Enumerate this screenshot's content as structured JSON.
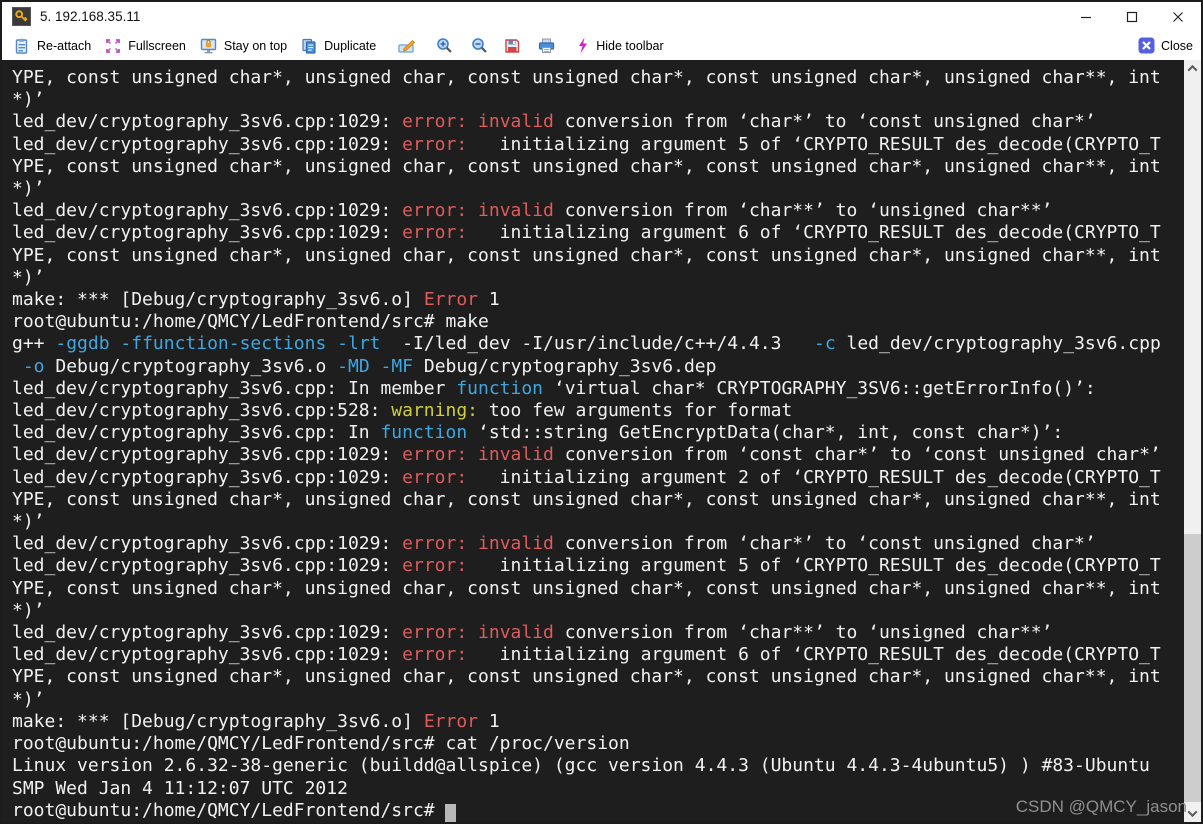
{
  "window": {
    "title": "5. 192.168.35.11",
    "controls": {
      "minimize": "minimize",
      "maximize": "maximize",
      "close": "close"
    }
  },
  "toolbar": {
    "items": [
      {
        "icon": "reattach-icon",
        "label": "Re-attach"
      },
      {
        "icon": "fullscreen-icon",
        "label": "Fullscreen"
      },
      {
        "icon": "stay-on-top-icon",
        "label": "Stay on top"
      },
      {
        "icon": "duplicate-icon",
        "label": "Duplicate"
      },
      {
        "icon": "edit-icon",
        "label": ""
      },
      {
        "icon": "zoom-in-icon",
        "label": ""
      },
      {
        "icon": "zoom-out-icon",
        "label": ""
      },
      {
        "icon": "save-icon",
        "label": ""
      },
      {
        "icon": "print-icon",
        "label": ""
      },
      {
        "icon": "lightning-icon",
        "label": "Hide toolbar"
      }
    ],
    "close_label": "Close"
  },
  "terminal": {
    "colors": {
      "bg": "#1e1e1e",
      "fg": "#f1f1f1",
      "red": "#e05b5b",
      "yellow": "#cfcf3e",
      "cyan": "#3fa7e0",
      "cursor": "#b8b8b8"
    },
    "lines": [
      [
        [
          "w",
          "YPE, const unsigned char*, unsigned char, const unsigned char*, const unsigned char*, unsigned char**, int"
        ]
      ],
      [
        [
          "w",
          "*)’"
        ]
      ],
      [
        [
          "w",
          "led_dev/cryptography_3sv6.cpp:1029: "
        ],
        [
          "r",
          "error:"
        ],
        [
          "w",
          " "
        ],
        [
          "r",
          "invalid"
        ],
        [
          "w",
          " conversion from ‘char*’ to ‘const unsigned char*’"
        ]
      ],
      [
        [
          "w",
          "led_dev/cryptography_3sv6.cpp:1029: "
        ],
        [
          "r",
          "error:"
        ],
        [
          "w",
          "   initializing argument 5 of ‘CRYPTO_RESULT des_decode(CRYPTO_T"
        ]
      ],
      [
        [
          "w",
          "YPE, const unsigned char*, unsigned char, const unsigned char*, const unsigned char*, unsigned char**, int"
        ]
      ],
      [
        [
          "w",
          "*)’"
        ]
      ],
      [
        [
          "w",
          "led_dev/cryptography_3sv6.cpp:1029: "
        ],
        [
          "r",
          "error:"
        ],
        [
          "w",
          " "
        ],
        [
          "r",
          "invalid"
        ],
        [
          "w",
          " conversion from ‘char**’ to ‘unsigned char**’"
        ]
      ],
      [
        [
          "w",
          "led_dev/cryptography_3sv6.cpp:1029: "
        ],
        [
          "r",
          "error:"
        ],
        [
          "w",
          "   initializing argument 6 of ‘CRYPTO_RESULT des_decode(CRYPTO_T"
        ]
      ],
      [
        [
          "w",
          "YPE, const unsigned char*, unsigned char, const unsigned char*, const unsigned char*, unsigned char**, int"
        ]
      ],
      [
        [
          "w",
          "*)’"
        ]
      ],
      [
        [
          "w",
          "make: *** [Debug/cryptography_3sv6.o] "
        ],
        [
          "r",
          "Error"
        ],
        [
          "w",
          " 1"
        ]
      ],
      [
        [
          "w",
          "root@ubuntu:/home/QMCY/LedFrontend/src# make"
        ]
      ],
      [
        [
          "w",
          "g++ "
        ],
        [
          "c",
          "-ggdb"
        ],
        [
          "w",
          " "
        ],
        [
          "c",
          "-ffunction-sections"
        ],
        [
          "w",
          " "
        ],
        [
          "c",
          "-lrt"
        ],
        [
          "w",
          "  -I/led_dev -I/usr/include/c++/4.4.3   "
        ],
        [
          "c",
          "-c"
        ],
        [
          "w",
          " led_dev/cryptography_3sv6.cpp"
        ]
      ],
      [
        [
          "w",
          " "
        ],
        [
          "c",
          "-o"
        ],
        [
          "w",
          " Debug/cryptography_3sv6.o "
        ],
        [
          "c",
          "-MD"
        ],
        [
          "w",
          " "
        ],
        [
          "c",
          "-MF"
        ],
        [
          "w",
          " Debug/cryptography_3sv6.dep"
        ]
      ],
      [
        [
          "w",
          "led_dev/cryptography_3sv6.cpp: In member "
        ],
        [
          "c",
          "function"
        ],
        [
          "w",
          " ‘virtual char* CRYPTOGRAPHY_3SV6::getErrorInfo()’:"
        ]
      ],
      [
        [
          "w",
          "led_dev/cryptography_3sv6.cpp:528: "
        ],
        [
          "y",
          "warning:"
        ],
        [
          "w",
          " too few arguments for format"
        ]
      ],
      [
        [
          "w",
          "led_dev/cryptography_3sv6.cpp: In "
        ],
        [
          "c",
          "function"
        ],
        [
          "w",
          " ‘std::string GetEncryptData(char*, int, const char*)’:"
        ]
      ],
      [
        [
          "w",
          "led_dev/cryptography_3sv6.cpp:1029: "
        ],
        [
          "r",
          "error:"
        ],
        [
          "w",
          " "
        ],
        [
          "r",
          "invalid"
        ],
        [
          "w",
          " conversion from ‘const char*’ to ‘const unsigned char*’"
        ]
      ],
      [
        [
          "w",
          "led_dev/cryptography_3sv6.cpp:1029: "
        ],
        [
          "r",
          "error:"
        ],
        [
          "w",
          "   initializing argument 2 of ‘CRYPTO_RESULT des_decode(CRYPTO_T"
        ]
      ],
      [
        [
          "w",
          "YPE, const unsigned char*, unsigned char, const unsigned char*, const unsigned char*, unsigned char**, int"
        ]
      ],
      [
        [
          "w",
          "*)’"
        ]
      ],
      [
        [
          "w",
          "led_dev/cryptography_3sv6.cpp:1029: "
        ],
        [
          "r",
          "error:"
        ],
        [
          "w",
          " "
        ],
        [
          "r",
          "invalid"
        ],
        [
          "w",
          " conversion from ‘char*’ to ‘const unsigned char*’"
        ]
      ],
      [
        [
          "w",
          "led_dev/cryptography_3sv6.cpp:1029: "
        ],
        [
          "r",
          "error:"
        ],
        [
          "w",
          "   initializing argument 5 of ‘CRYPTO_RESULT des_decode(CRYPTO_T"
        ]
      ],
      [
        [
          "w",
          "YPE, const unsigned char*, unsigned char, const unsigned char*, const unsigned char*, unsigned char**, int"
        ]
      ],
      [
        [
          "w",
          "*)’"
        ]
      ],
      [
        [
          "w",
          "led_dev/cryptography_3sv6.cpp:1029: "
        ],
        [
          "r",
          "error:"
        ],
        [
          "w",
          " "
        ],
        [
          "r",
          "invalid"
        ],
        [
          "w",
          " conversion from ‘char**’ to ‘unsigned char**’"
        ]
      ],
      [
        [
          "w",
          "led_dev/cryptography_3sv6.cpp:1029: "
        ],
        [
          "r",
          "error:"
        ],
        [
          "w",
          "   initializing argument 6 of ‘CRYPTO_RESULT des_decode(CRYPTO_T"
        ]
      ],
      [
        [
          "w",
          "YPE, const unsigned char*, unsigned char, const unsigned char*, const unsigned char*, unsigned char**, int"
        ]
      ],
      [
        [
          "w",
          "*)’"
        ]
      ],
      [
        [
          "w",
          "make: *** [Debug/cryptography_3sv6.o] "
        ],
        [
          "r",
          "Error"
        ],
        [
          "w",
          " 1"
        ]
      ],
      [
        [
          "w",
          "root@ubuntu:/home/QMCY/LedFrontend/src# cat /proc/version"
        ]
      ],
      [
        [
          "w",
          "Linux version 2.6.32-38-generic (buildd@allspice) (gcc version 4.4.3 (Ubuntu 4.4.3-4ubuntu5) ) #83-Ubuntu"
        ]
      ],
      [
        [
          "w",
          "SMP Wed Jan 4 11:12:07 UTC 2012"
        ]
      ],
      [
        [
          "w",
          "root@ubuntu:/home/QMCY/LedFrontend/src# "
        ],
        [
          "cursor",
          ""
        ]
      ]
    ]
  },
  "watermark": "CSDN @QMCY_jason"
}
